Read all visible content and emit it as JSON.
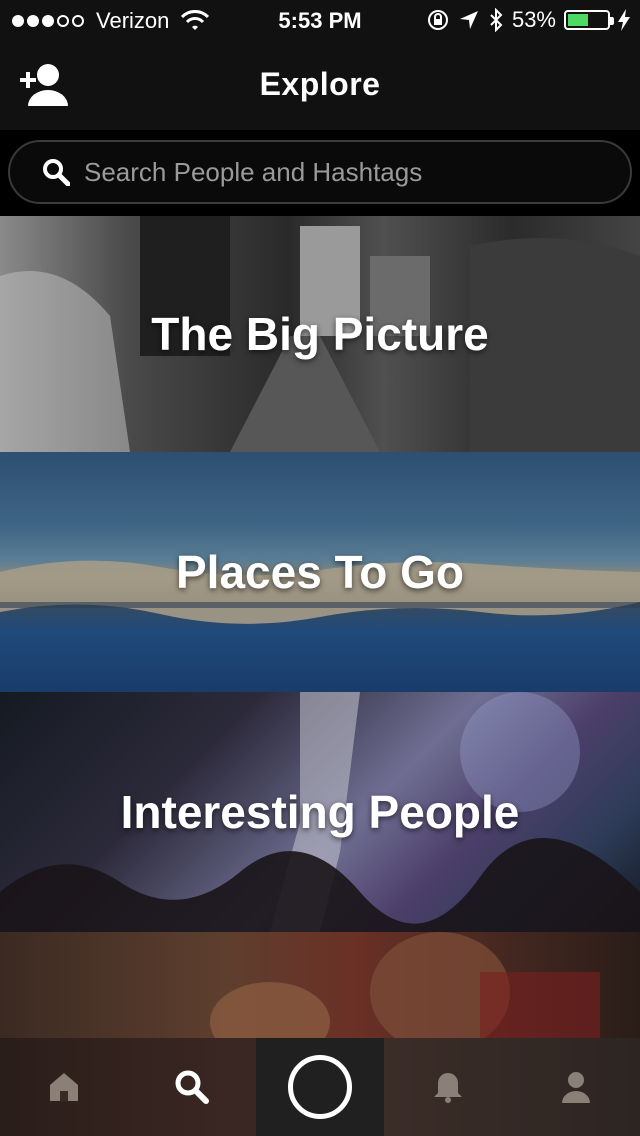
{
  "status_bar": {
    "carrier": "Verizon",
    "time": "5:53 PM",
    "battery_percent": "53%",
    "battery_level": 0.53,
    "signal_dots_full": 3,
    "signal_dots_total": 5,
    "battery_color": "#4cd964"
  },
  "nav": {
    "title": "Explore",
    "left_icon": "add-user-icon"
  },
  "search": {
    "placeholder": "Search People and Hashtags",
    "value": ""
  },
  "tiles": [
    {
      "label": "The Big Picture"
    },
    {
      "label": "Places To Go"
    },
    {
      "label": "Interesting People"
    },
    {
      "label": ""
    }
  ],
  "tab_bar": {
    "tabs": [
      {
        "icon": "home-icon"
      },
      {
        "icon": "search-icon"
      },
      {
        "icon": "camera-shutter-icon"
      },
      {
        "icon": "bell-icon"
      },
      {
        "icon": "profile-icon"
      }
    ],
    "active_tab": "search"
  }
}
